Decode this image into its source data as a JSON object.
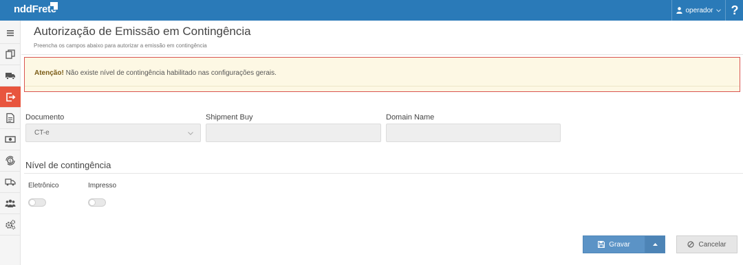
{
  "app": {
    "logo_text": "nddFrete",
    "user": "operador",
    "help_label": "?"
  },
  "sidebar": {
    "items": [
      {
        "icon": "menu-icon",
        "active": false
      },
      {
        "icon": "documents-icon",
        "active": false
      },
      {
        "icon": "truck-icon",
        "active": false
      },
      {
        "icon": "export-icon",
        "active": true
      },
      {
        "icon": "document-icon",
        "active": false
      },
      {
        "icon": "money-icon",
        "active": false
      },
      {
        "icon": "coin-cycle-icon",
        "active": false
      },
      {
        "icon": "trucks-icon",
        "active": false
      },
      {
        "icon": "users-icon",
        "active": false
      },
      {
        "icon": "gears-icon",
        "active": false
      }
    ]
  },
  "page": {
    "title": "Autorização de Emissão em Contingência",
    "subtitle": "Preencha os campos abaixo para autorizar a emissão em contingência"
  },
  "alert": {
    "strong": "Atenção!",
    "message": " Não existe nível de contingência habilitado nas configurações gerais."
  },
  "form": {
    "documento_label": "Documento",
    "documento_value": "CT-e",
    "shipment_label": "Shipment Buy",
    "shipment_value": "",
    "domain_label": "Domain Name",
    "domain_value": ""
  },
  "contingencia": {
    "section_title": "Nível de contingência",
    "eletronico_label": "Eletrônico",
    "eletronico_on": false,
    "impresso_label": "Impresso",
    "impresso_on": false
  },
  "actions": {
    "save_label": "Gravar",
    "cancel_label": "Cancelar"
  },
  "colors": {
    "topbar": "#2a7ab8",
    "active_sidebar": "#e8553e",
    "save_button": "#5b93c6",
    "alert_border": "#d9534f",
    "alert_background": "#fdf8e4"
  }
}
